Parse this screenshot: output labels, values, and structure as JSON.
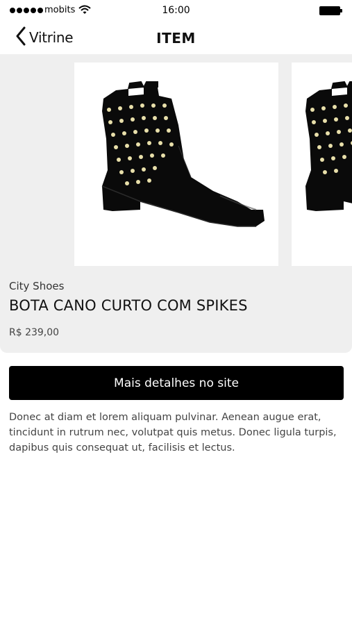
{
  "status_bar": {
    "carrier": "mobits",
    "time": "16:00",
    "signal_icon": "signal-dots-icon",
    "wifi_icon": "wifi-icon",
    "battery_icon": "battery-icon"
  },
  "nav": {
    "back_label": "Vitrine",
    "back_icon": "chevron-left-icon",
    "title": "ITEM"
  },
  "product": {
    "brand": "City Shoes",
    "name": "BOTA CANO CURTO COM SPIKES",
    "price": "R$ 239,00",
    "images": [
      "boot-image",
      "boot-image"
    ]
  },
  "cta": {
    "label": "Mais detalhes no site"
  },
  "description": "Donec at diam et lorem aliquam pulvinar. Aenean augue erat, tincidunt in rutrum nec, volutpat quis metus. Donec ligula turpis, dapibus quis consequat ut, facilisis et lectus.",
  "colors": {
    "background": "#ffffff",
    "card": "#efefef",
    "button": "#000000",
    "button_text": "#ffffff"
  }
}
